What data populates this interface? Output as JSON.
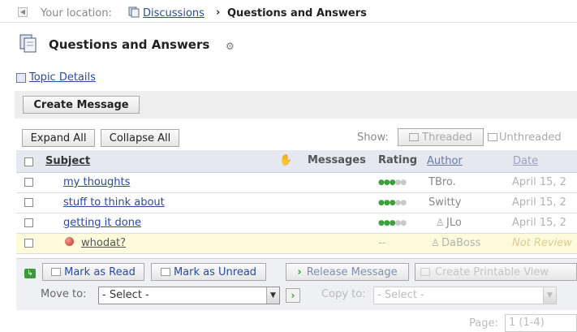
{
  "breadcrumb": {
    "prefix": "Your location:",
    "parent": "Discussions",
    "separator": "›",
    "current": "Questions and Answers"
  },
  "page_title": "Questions and Answers",
  "topic_details_link": "Topic Details",
  "create_message_label": "Create Message",
  "toolbar": {
    "expand_all": "Expand All",
    "collapse_all": "Collapse All",
    "show_label": "Show:",
    "threaded": "Threaded",
    "unthreaded": "Unthreaded"
  },
  "table": {
    "headers": {
      "subject": "Subject",
      "messages": "Messages",
      "rating": "Rating",
      "author": "Author",
      "date": "Date"
    },
    "rows": [
      {
        "subject": "my thoughts",
        "rating": 3,
        "author": "TBro.",
        "date": "April 15, 2",
        "pending": false
      },
      {
        "subject": "stuff to think about",
        "rating": 3,
        "author": "Switty",
        "date": "April 15, 2",
        "pending": false
      },
      {
        "subject": "getting it done",
        "rating": 3,
        "author": "JLo",
        "date": "April 15, 2",
        "pending": false
      },
      {
        "subject": "whodat?",
        "rating_text": "--",
        "author": "DaBoss",
        "date": "Not Review",
        "pending": true
      }
    ]
  },
  "actions": {
    "mark_as_read": "Mark as Read",
    "mark_as_unread": "Mark as Unread",
    "release_message": "Release Message",
    "create_printable": "Create Printable View",
    "move_to_label": "Move to:",
    "move_to_value": "- Select -",
    "copy_to_label": "Copy to:",
    "copy_to_value": "- Select -"
  },
  "pagination": {
    "label": "Page:",
    "value": "1 (1-4)"
  },
  "colors": {
    "link": "#2a4aa0",
    "header_bg": "#e5e8ee",
    "pending_row_bg": "#fdfbdc",
    "action_bar_bg": "#eef0f3",
    "star_on": "#3aa03a"
  }
}
